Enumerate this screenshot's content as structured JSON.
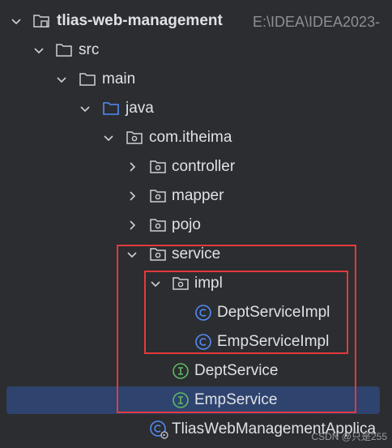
{
  "project": {
    "name": "tlias-web-management",
    "path": "E:\\IDEA\\IDEA2023-"
  },
  "tree": {
    "src": "src",
    "main": "main",
    "java": "java",
    "package": "com.itheima",
    "controller": "controller",
    "mapper": "mapper",
    "pojo": "pojo",
    "service": "service",
    "impl": "impl",
    "dept_service_impl": "DeptServiceImpl",
    "emp_service_impl": "EmpServiceImpl",
    "dept_service": "DeptService",
    "emp_service": "EmpService",
    "application": "TliasWebManagementApplica"
  },
  "icons": {
    "folder": "folder-icon",
    "source_folder": "source-folder-icon",
    "package": "package-icon",
    "class": "class-icon",
    "interface": "interface-icon"
  },
  "colors": {
    "background": "#2b2d30",
    "selection": "#2e436e",
    "highlight_box": "#e5393d",
    "class_icon": "#548af7",
    "interface_icon": "#5fb865"
  },
  "watermark": "CSDN @只是255"
}
